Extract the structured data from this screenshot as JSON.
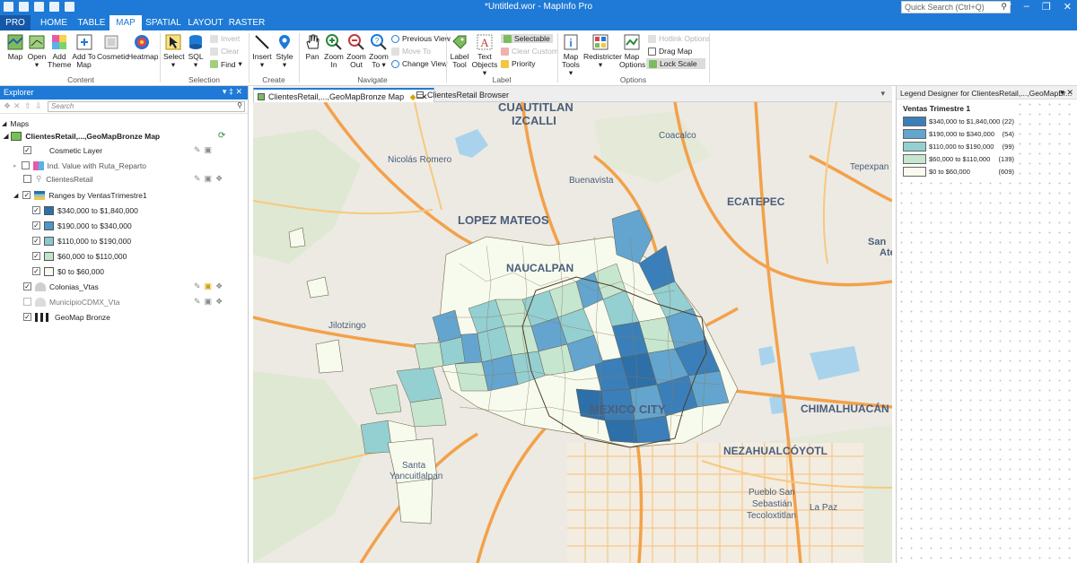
{
  "window": {
    "title": "*Untitled.wor - MapInfo Pro",
    "quick_search_placeholder": "Quick Search (Ctrl+Q)",
    "help": "?"
  },
  "ribbon_tabs": [
    "PRO",
    "HOME",
    "TABLE",
    "MAP",
    "SPATIAL",
    "LAYOUT",
    "RASTER"
  ],
  "ribbon": {
    "content": {
      "label": "Content",
      "map": "Map",
      "open": "Open",
      "add_theme": "Add Theme",
      "add_to_map": "Add To Map",
      "cosmetic": "Cosmetic",
      "heatmap": "Heatmap"
    },
    "selection": {
      "label": "Selection",
      "select": "Select",
      "sql": "SQL",
      "invert": "Invert",
      "clear": "Clear",
      "find": "Find"
    },
    "create": {
      "label": "Create",
      "insert": "Insert",
      "style": "Style"
    },
    "navigate": {
      "label": "Navigate",
      "pan": "Pan",
      "zoom_in": "Zoom In",
      "zoom_out": "Zoom Out",
      "zoom_to": "Zoom To",
      "previous_view": "Previous View",
      "move_to": "Move To",
      "change_view": "Change View"
    },
    "label_group": {
      "label": "Label",
      "label_tool": "Label Tool",
      "text_objects": "Text Objects",
      "selectable": "Selectable",
      "clear_custom": "Clear Custom",
      "priority": "Priority"
    },
    "options": {
      "label": "Options",
      "map_tools": "Map Tools",
      "redistricter": "Redistricter",
      "map_options": "Map Options",
      "hotlink_options": "Hotlink Options",
      "drag_map": "Drag Map",
      "lock_scale": "Lock Scale"
    }
  },
  "explorer": {
    "title": "Explorer",
    "search_placeholder": "Search",
    "section": "Maps",
    "map_name": "ClientesRetail,...,GeoMapBronze Map",
    "layers": [
      {
        "name": "Cosmetic Layer",
        "checked": true
      },
      {
        "name": "Ind. Value with Ruta_Reparto",
        "checked": false
      },
      {
        "name": "ClientesRetail",
        "checked": false
      },
      {
        "name": "Ranges by VentasTrimestre1",
        "checked": true
      },
      {
        "name": "Colonias_Vtas",
        "checked": true
      },
      {
        "name": "MunicipioCDMX_Vta",
        "checked": false
      },
      {
        "name": "GeoMap Bronze",
        "checked": true
      }
    ],
    "ranges": [
      {
        "label": "$340,000 to  $1,840,000",
        "color": "#2d6fa8"
      },
      {
        "label": "$190,000 to $340,000",
        "color": "#4f97c6"
      },
      {
        "label": "$110,000 to $190,000",
        "color": "#8cc7cf"
      },
      {
        "label": "$60,000 to $110,000",
        "color": "#c3e3cf"
      },
      {
        "label": "$0 to $60,000",
        "color": "#f7fbee"
      }
    ]
  },
  "doc_tabs": [
    "ClientesRetail,...,GeoMapBronze Map",
    "ClientesRetail Browser"
  ],
  "legend": {
    "panel_title": "Legend Designer for ClientesRetail,...,GeoMapBr...",
    "title": "Ventas Trimestre 1",
    "rows": [
      {
        "label": "$340,000 to  $1,840,000",
        "count": "(22)",
        "color": "#3a7fb9"
      },
      {
        "label": "$190,000 to $340,000",
        "count": "(54)",
        "color": "#63a5cf"
      },
      {
        "label": "$110,000 to $190,000",
        "count": "(99)",
        "color": "#94cfd2"
      },
      {
        "label": "$60,000 to $110,000",
        "count": "(139)",
        "color": "#c6e6cf"
      },
      {
        "label": "$0 to $60,000",
        "count": "(609)",
        "color": "#f8fbee"
      }
    ]
  },
  "map_labels": {
    "cuautitlan": "CUAUTITLAN",
    "izcalli": "IZCALLI",
    "coacalco": "Coacalco",
    "nicolas_romero": "Nicolás Romero",
    "buenavista": "Buenavista",
    "tepexpan": "Tepexpan",
    "ecatepec": "ECATEPEC",
    "lopez_mateos": "LOPEZ MATEOS",
    "san": "San",
    "atenco": "Ate",
    "naucalpan": "NAUCALPAN",
    "jilotzingo": "Jilotzingo",
    "mexico_city": "MEXICO CITY",
    "chimalhuacan": "CHIMALHUACÁN",
    "nezahualcoyotl": "NEZAHUALCÓYOTL",
    "santa": "Santa",
    "yancuitlalpan": "Yancuitlalpan",
    "pueblo_san": "Pueblo San",
    "sebastian": "Sebastián",
    "tecoloxtitlan": "Tecoloxtitlan",
    "la_paz": "La Paz"
  }
}
